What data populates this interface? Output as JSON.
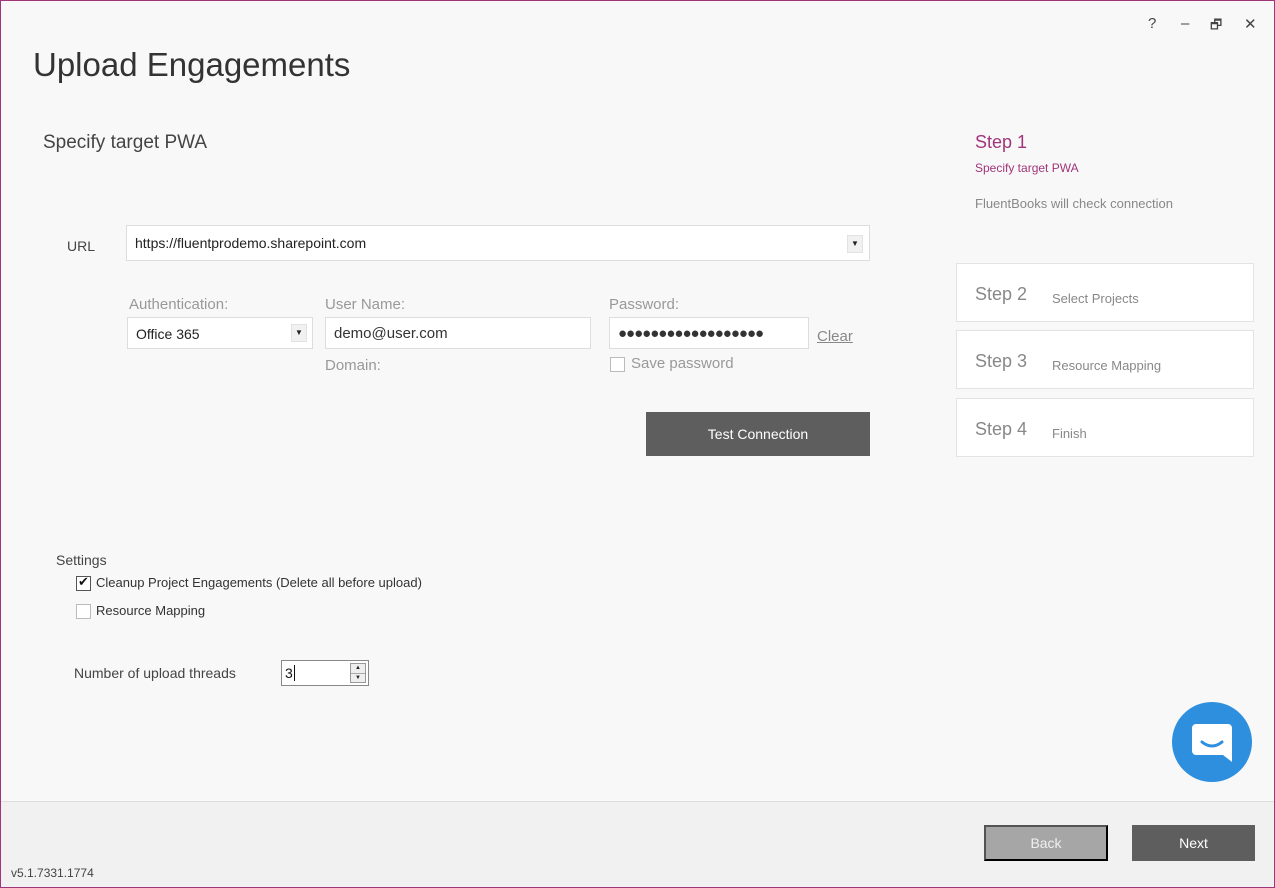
{
  "window": {
    "title": "Upload Engagements",
    "controls": {
      "help": "?",
      "minimize": "–",
      "restore": "🗗",
      "close": "✕"
    }
  },
  "main": {
    "section_title": "Specify target PWA",
    "url": {
      "label": "URL",
      "value": "https://fluentprodemo.sharepoint.com"
    },
    "authentication": {
      "label": "Authentication:",
      "value": "Office 365"
    },
    "username": {
      "label": "User Name:",
      "value": "demo@user.com"
    },
    "domain": {
      "label": "Domain:"
    },
    "password": {
      "label": "Password:",
      "masked": "●●●●●●●●●●●●●●●●●●",
      "clear_label": "Clear"
    },
    "save_password": {
      "label": "Save password",
      "checked": false
    },
    "test_connection_label": "Test Connection"
  },
  "settings": {
    "label": "Settings",
    "cleanup": {
      "label": "Cleanup Project Engagements (Delete all before upload)",
      "checked": true
    },
    "resource_mapping": {
      "label": "Resource Mapping",
      "checked": false
    },
    "threads": {
      "label": "Number of upload threads",
      "value": "3"
    }
  },
  "steps": {
    "current": {
      "title": "Step 1",
      "subtitle": "Specify target PWA",
      "description": "FluentBooks will check connection"
    },
    "items": [
      {
        "number": "Step 2",
        "name": "Select Projects"
      },
      {
        "number": "Step 3",
        "name": "Resource Mapping"
      },
      {
        "number": "Step 4",
        "name": "Finish"
      }
    ]
  },
  "footer": {
    "back_label": "Back",
    "next_label": "Next",
    "version": "v5.1.7331.1774"
  },
  "colors": {
    "accent": "#a0357b",
    "chat": "#2d8fde",
    "button_dark": "#5e5e5e"
  },
  "icons": {
    "chat": "chat-bubble-icon",
    "checkmark": "checkmark-icon",
    "dropdown": "chevron-down-icon"
  }
}
